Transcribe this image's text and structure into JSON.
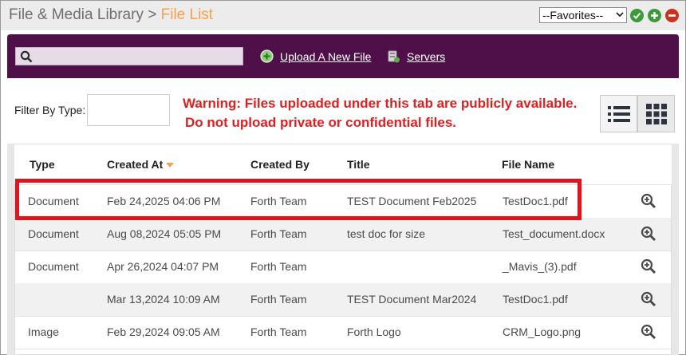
{
  "header": {
    "breadcrumb_root": "File & Media Library",
    "breadcrumb_separator": ">",
    "breadcrumb_current": "File List",
    "favorites_selected": "--Favorites--"
  },
  "toolbar": {
    "search_placeholder": "",
    "upload_label": "Upload A New File",
    "servers_label": "Servers"
  },
  "filter": {
    "label": "Filter By Type:",
    "value": ""
  },
  "warning": {
    "line1": "Warning: Files uploaded under this tab are publicly available.",
    "line2": "Do not upload private or confidential files."
  },
  "table": {
    "headers": [
      "Type",
      "Created At",
      "Created By",
      "Title",
      "File Name"
    ],
    "sort_column": "Created At",
    "rows": [
      {
        "type": "Document",
        "created_at": "Feb 24,2025 04:06 PM",
        "created_by": "Forth Team",
        "title": "TEST Document Feb2025",
        "file_name": "TestDoc1.pdf"
      },
      {
        "type": "Document",
        "created_at": "Aug 08,2024 05:05 PM",
        "created_by": "Forth Team",
        "title": "test doc for size",
        "file_name": "Test_document.docx"
      },
      {
        "type": "Document",
        "created_at": "Apr 26,2024 04:07 PM",
        "created_by": "Forth Team",
        "title": "",
        "file_name": "_Mavis_(3).pdf"
      },
      {
        "type": "",
        "created_at": "Mar 13,2024 10:09 AM",
        "created_by": "Forth Team",
        "title": "TEST Document Mar2024",
        "file_name": "TestDoc1.pdf"
      },
      {
        "type": "Image",
        "created_at": "Feb 29,2024 09:05 AM",
        "created_by": "Forth Team",
        "title": "Forth Logo",
        "file_name": "CRM_Logo.png"
      }
    ]
  },
  "colors": {
    "accent_orange": "#f5a04a",
    "toolbar_purple": "#4f0f48",
    "warning_red": "#e02020",
    "highlight_red": "#e0141e"
  }
}
